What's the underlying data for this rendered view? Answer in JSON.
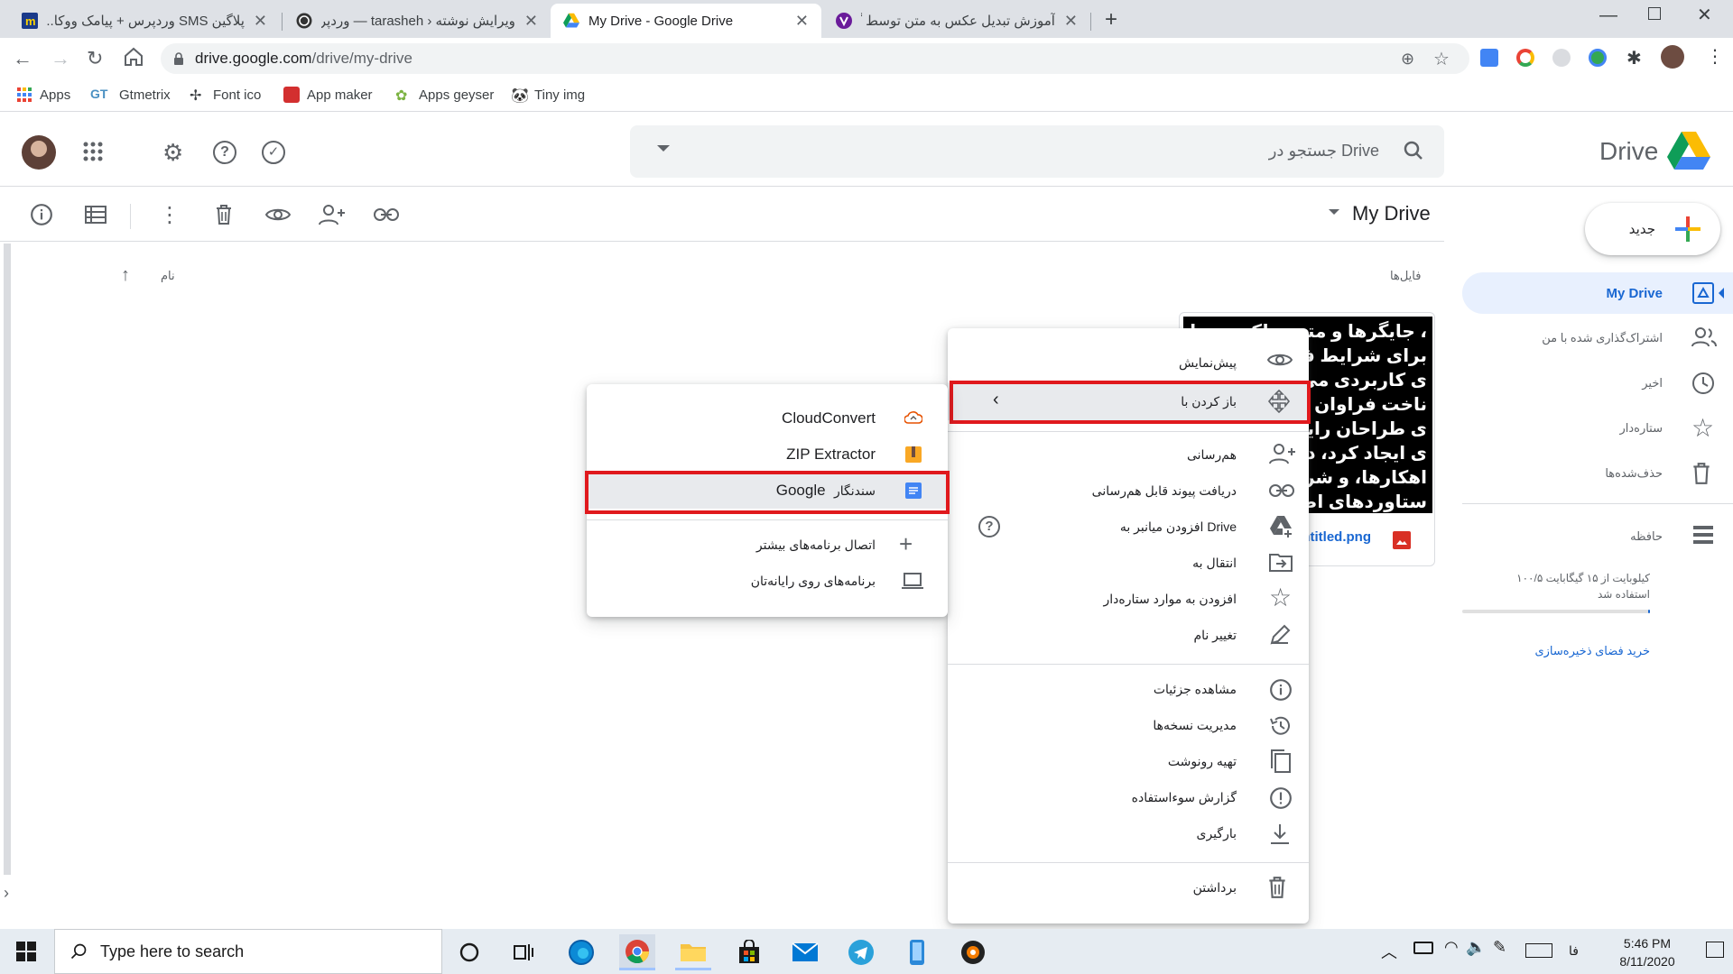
{
  "browser": {
    "tabs": [
      {
        "title": "پلاگین SMS وردپرس + پیامک ووکا...",
        "active": false
      },
      {
        "title": "ویرایش نوشته ‹ tarasheh — وردپر...",
        "active": false
      },
      {
        "title": "My Drive - Google Drive",
        "active": true
      },
      {
        "title": "آموزش تبدیل عکس به متن توسط گ...",
        "active": false
      }
    ],
    "url_host": "drive.google.com",
    "url_path": "/drive/my-drive",
    "bookmarks": [
      {
        "label": "Apps",
        "icon": "apps-grid-icon"
      },
      {
        "label": "Gtmetrix",
        "icon": "gtmetrix-icon"
      },
      {
        "label": "Font ico",
        "icon": "font-icon"
      },
      {
        "label": "App maker",
        "icon": "app-maker-icon"
      },
      {
        "label": "Apps geyser",
        "icon": "apps-geyser-icon"
      },
      {
        "label": "Tiny img",
        "icon": "tiny-img-icon"
      }
    ]
  },
  "drive": {
    "logo_text": "Drive",
    "search_placeholder": "جستجو در Drive",
    "breadcrumb": "My Drive",
    "new_button": "جدید",
    "files_heading": "فایل‌ها",
    "sort_label": "نام",
    "file_name": "Untitled.png",
    "preview_lines": [
      "، جایگرها و متون بلکه روزنامه و مجل",
      "برای شرایط فعلی تک",
      "ی کاربردی می باشد",
      "ناخت فراوان جامع",
      "ی طراحان رایانه ای",
      "ی ایجاد کرد، در این",
      "اهکارها، و شرایط سخ",
      "ستاوردهای اصلی، و"
    ],
    "nav": [
      {
        "label": "My Drive",
        "active": true
      },
      {
        "label": "اشتراک‌گذاری شده با من",
        "active": false
      },
      {
        "label": "اخیر",
        "active": false
      },
      {
        "label": "ستاره‌دار",
        "active": false
      },
      {
        "label": "حذف‌شده‌ها",
        "active": false
      }
    ],
    "storage_label": "حافظه",
    "storage_usage_line1": "۱۰۰/۵ کیلوبایت از ۱۵ گیگابایت",
    "storage_usage_line2": "استفاده شد",
    "storage_fraction": 6.7e-06,
    "buy_storage": "خرید فضای ذخیره‌سازی"
  },
  "context_menu": {
    "preview": "پیش‌نمایش",
    "open_with": "باز کردن با",
    "share": "هم‌رسانی",
    "get_link": "دریافت پیوند قابل هم‌رسانی",
    "add_shortcut": "افزودن میانبر به Drive",
    "move_to": "انتقال به",
    "add_starred": "افزودن به موارد ستاره‌دار",
    "rename": "تغییر نام",
    "view_details": "مشاهده جزئیات",
    "manage_versions": "مدیریت نسخه‌ها",
    "make_copy": "تهیه رونوشت",
    "report_abuse": "گزارش سوءاستفاده",
    "download": "بارگیری",
    "remove": "برداشتن"
  },
  "submenu": {
    "cloudconvert": "CloudConvert",
    "zip_extractor": "ZIP Extractor",
    "google_docs_prefix": "سندنگار",
    "google_docs_suffix": "Google",
    "connect_more": "اتصال برنامه‌های بیشتر",
    "computer_apps": "برنامه‌های روی رایانه‌تان"
  },
  "taskbar": {
    "search_placeholder": "Type here to search",
    "lang": "فا",
    "time": "5:46 PM",
    "date": "8/11/2020"
  },
  "colors": {
    "highlight_border": "#e0191d",
    "accent_blue": "#1967d2",
    "docs_blue": "#4285f4"
  }
}
